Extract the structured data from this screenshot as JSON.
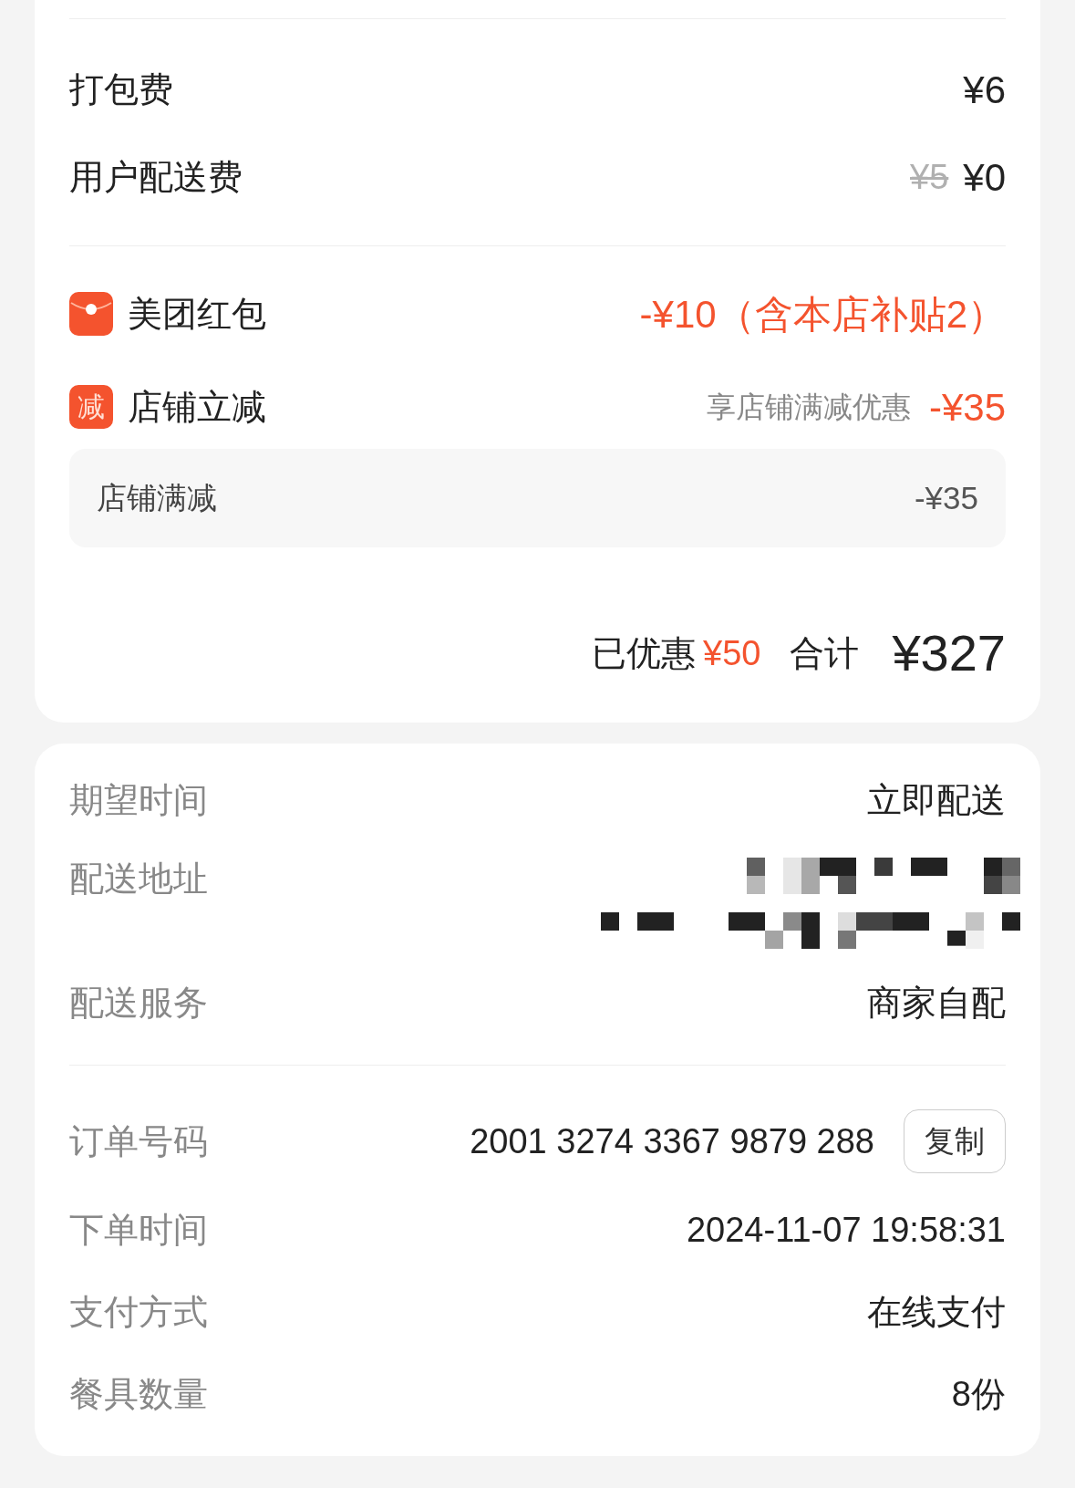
{
  "fees": [
    {
      "label": "打包费",
      "amount": "¥6"
    },
    {
      "label": "用户配送费",
      "original_amount": "¥5",
      "amount": "¥0"
    }
  ],
  "discounts": [
    {
      "kind": "red_packet",
      "label": "美团红包",
      "amount": "-¥10（含本店补贴2）"
    },
    {
      "kind": "shop",
      "icon_text": "减",
      "label": "店铺立减",
      "note": "享店铺满减优惠",
      "amount": "-¥35",
      "details": [
        {
          "label": "店铺满减",
          "amount": "-¥35"
        }
      ]
    }
  ],
  "summary": {
    "saved_label": "已优惠",
    "saved_amount": "¥50",
    "total_label": "合计",
    "total": "¥327"
  },
  "delivery": [
    {
      "kind": "text",
      "label": "期望时间",
      "value": "立即配送"
    },
    {
      "kind": "redacted",
      "label": "配送地址"
    },
    {
      "kind": "text",
      "label": "配送服务",
      "value": "商家自配"
    }
  ],
  "order": [
    {
      "label": "订单号码",
      "value": "2001 3274 3367 9879 288",
      "action": "复制"
    },
    {
      "label": "下单时间",
      "value": "2024-11-07 19:58:31"
    },
    {
      "label": "支付方式",
      "value": "在线支付"
    },
    {
      "label": "餐具数量",
      "value": "8份"
    }
  ]
}
